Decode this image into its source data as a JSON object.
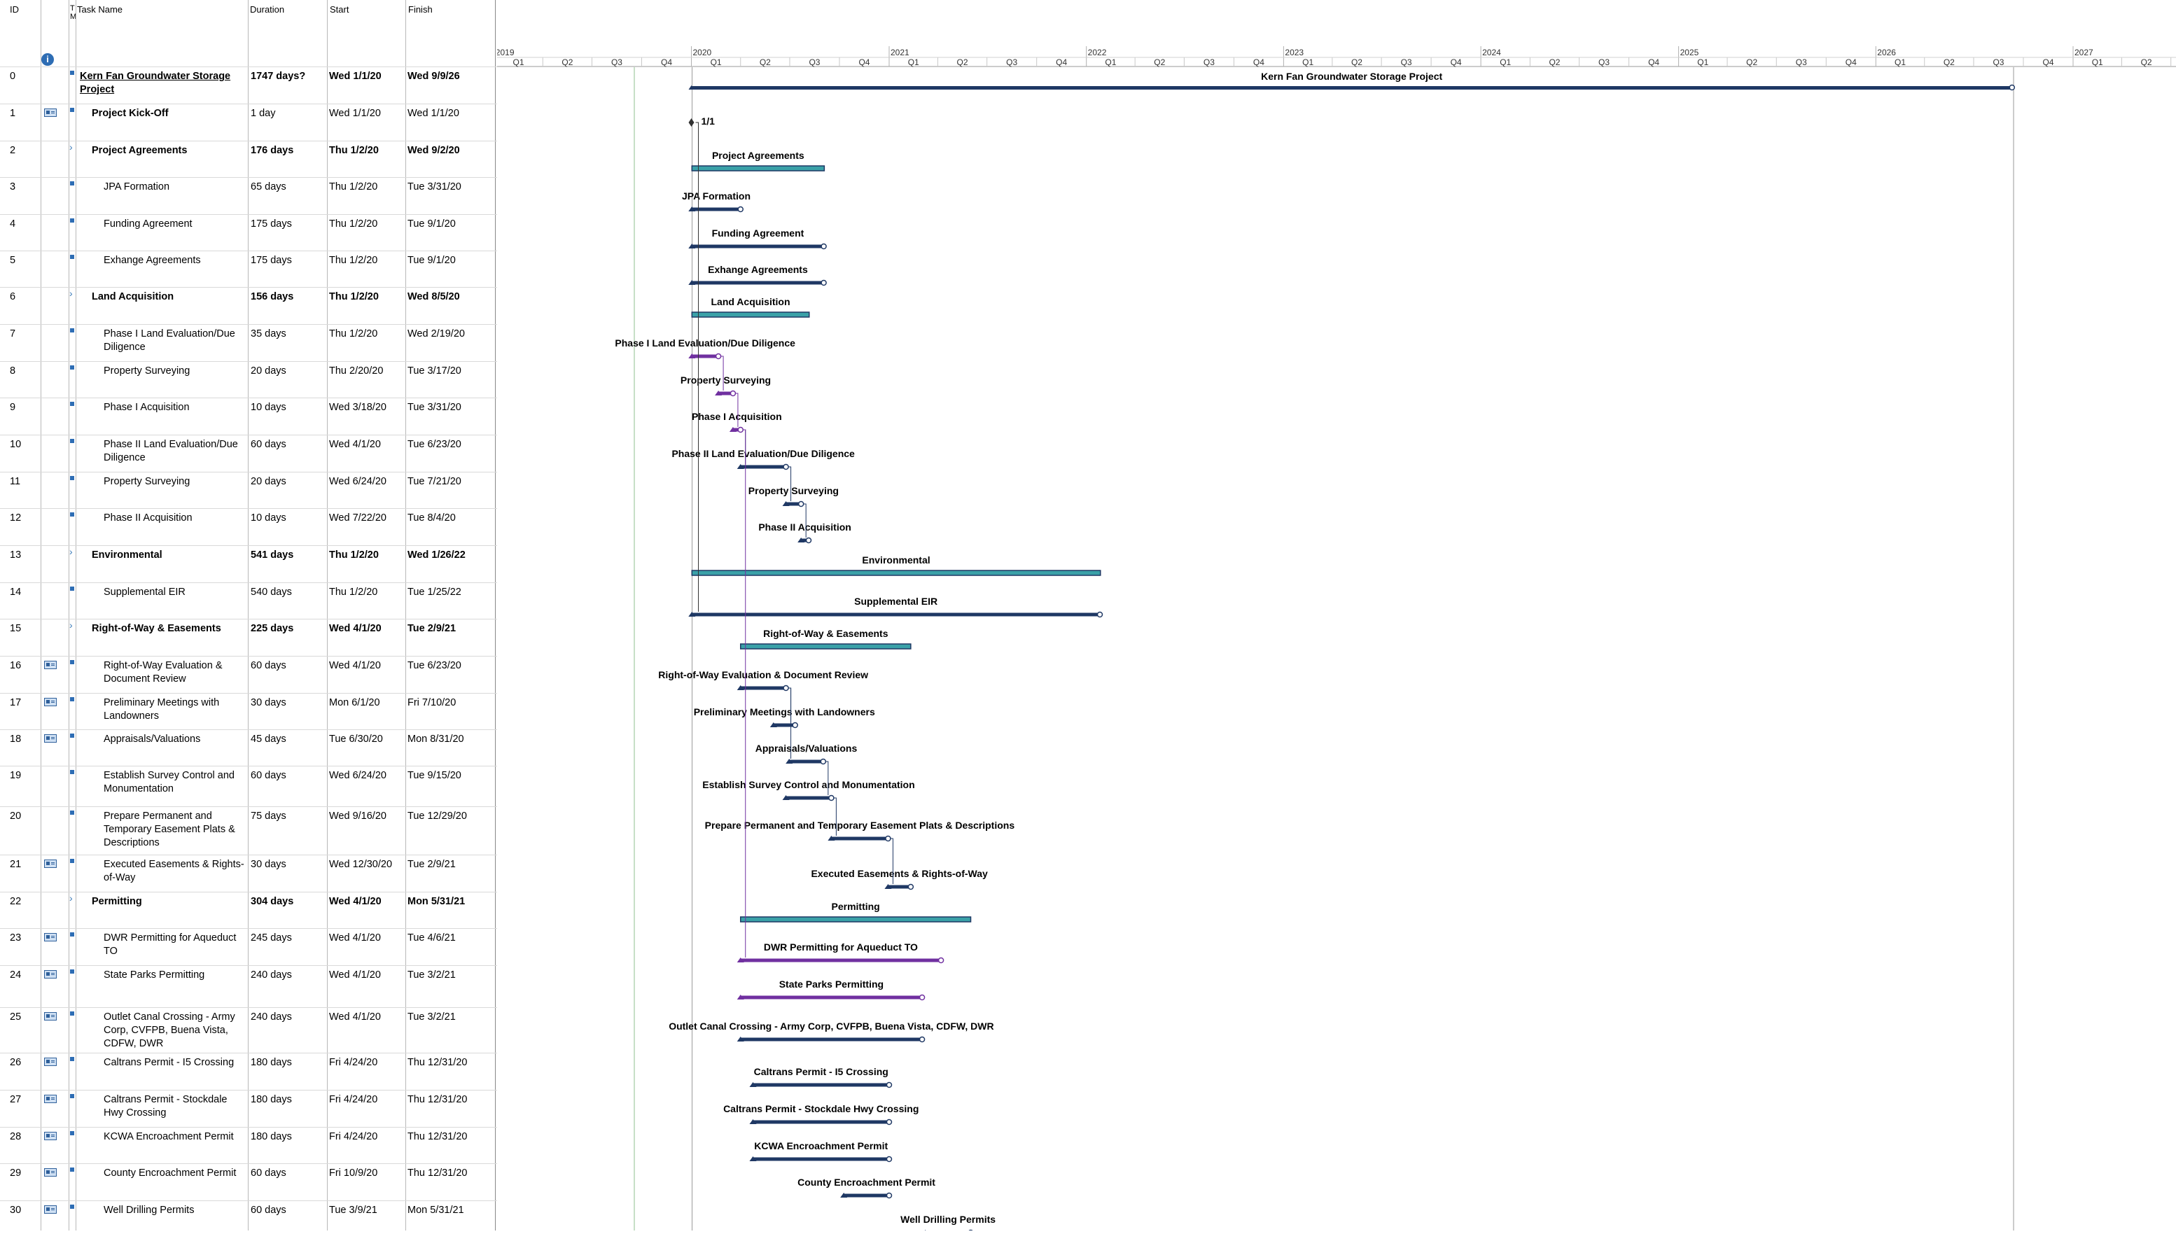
{
  "headers": {
    "id": "ID",
    "mode": "T M",
    "name": "Task Name",
    "duration": "Duration",
    "start": "Start",
    "finish": "Finish"
  },
  "timescale": {
    "years": [
      "2019",
      "2020",
      "2021",
      "2022",
      "2023",
      "2024",
      "2025",
      "2026",
      "2027"
    ],
    "quarters": [
      "Q1",
      "Q2",
      "Q3",
      "Q4"
    ]
  },
  "colors": {
    "task_bar": "#1f3864",
    "summary_bar": "#3aa1a8",
    "purple": "#7030a0",
    "link": "#333333"
  },
  "tasks": [
    {
      "id": "0",
      "name": "Kern Fan Groundwater Storage Project",
      "duration": "1747 days?",
      "start": "Wed 1/1/20",
      "finish": "Wed 9/9/26",
      "kind": "project",
      "has_note": false,
      "label": "Kern Fan Groundwater Storage Project"
    },
    {
      "id": "1",
      "name": "Project Kick-Off",
      "duration": "1 day",
      "start": "Wed 1/1/20",
      "finish": "Wed 1/1/20",
      "kind": "milestone",
      "has_note": true,
      "label": "1/1"
    },
    {
      "id": "2",
      "name": "Project Agreements",
      "duration": "176 days",
      "start": "Thu 1/2/20",
      "finish": "Wed 9/2/20",
      "kind": "summary",
      "has_note": false,
      "label": "Project Agreements"
    },
    {
      "id": "3",
      "name": "JPA Formation",
      "duration": "65 days",
      "start": "Thu 1/2/20",
      "finish": "Tue 3/31/20",
      "kind": "task",
      "has_note": false,
      "label": "JPA Formation"
    },
    {
      "id": "4",
      "name": "Funding Agreement",
      "duration": "175 days",
      "start": "Thu 1/2/20",
      "finish": "Tue 9/1/20",
      "kind": "task",
      "has_note": false,
      "label": "Funding Agreement"
    },
    {
      "id": "5",
      "name": "Exhange Agreements",
      "duration": "175 days",
      "start": "Thu 1/2/20",
      "finish": "Tue 9/1/20",
      "kind": "task",
      "has_note": false,
      "label": "Exhange Agreements"
    },
    {
      "id": "6",
      "name": "Land Acquisition",
      "duration": "156 days",
      "start": "Thu 1/2/20",
      "finish": "Wed 8/5/20",
      "kind": "summary",
      "has_note": false,
      "label": "Land Acquisition"
    },
    {
      "id": "7",
      "name": "Phase I Land Evaluation/Due Diligence",
      "duration": "35 days",
      "start": "Thu 1/2/20",
      "finish": "Wed 2/19/20",
      "kind": "critical",
      "has_note": false,
      "label": "Phase I Land Evaluation/Due Diligence"
    },
    {
      "id": "8",
      "name": "Property Surveying",
      "duration": "20 days",
      "start": "Thu 2/20/20",
      "finish": "Tue 3/17/20",
      "kind": "critical",
      "has_note": false,
      "label": "Property Surveying"
    },
    {
      "id": "9",
      "name": "Phase I Acquisition",
      "duration": "10 days",
      "start": "Wed 3/18/20",
      "finish": "Tue 3/31/20",
      "kind": "critical",
      "has_note": false,
      "label": "Phase I Acquisition"
    },
    {
      "id": "10",
      "name": "Phase II Land Evaluation/Due Diligence",
      "duration": "60 days",
      "start": "Wed 4/1/20",
      "finish": "Tue 6/23/20",
      "kind": "task",
      "has_note": false,
      "label": "Phase II Land Evaluation/Due Diligence"
    },
    {
      "id": "11",
      "name": "Property Surveying",
      "duration": "20 days",
      "start": "Wed 6/24/20",
      "finish": "Tue 7/21/20",
      "kind": "task",
      "has_note": false,
      "label": "Property Surveying"
    },
    {
      "id": "12",
      "name": "Phase II Acquisition",
      "duration": "10 days",
      "start": "Wed 7/22/20",
      "finish": "Tue 8/4/20",
      "kind": "task",
      "has_note": false,
      "label": "Phase II Acquisition"
    },
    {
      "id": "13",
      "name": "Environmental",
      "duration": "541 days",
      "start": "Thu 1/2/20",
      "finish": "Wed 1/26/22",
      "kind": "summary",
      "has_note": false,
      "label": "Environmental"
    },
    {
      "id": "14",
      "name": "Supplemental EIR",
      "duration": "540 days",
      "start": "Thu 1/2/20",
      "finish": "Tue 1/25/22",
      "kind": "task",
      "has_note": false,
      "label": "Supplemental EIR"
    },
    {
      "id": "15",
      "name": "Right-of-Way & Easements",
      "duration": "225 days",
      "start": "Wed 4/1/20",
      "finish": "Tue 2/9/21",
      "kind": "summary",
      "has_note": false,
      "label": "Right-of-Way & Easements"
    },
    {
      "id": "16",
      "name": "Right-of-Way Evaluation & Document Review",
      "duration": "60 days",
      "start": "Wed 4/1/20",
      "finish": "Tue 6/23/20",
      "kind": "task",
      "has_note": true,
      "label": "Right-of-Way Evaluation & Document Review"
    },
    {
      "id": "17",
      "name": "Preliminary Meetings with Landowners",
      "duration": "30 days",
      "start": "Mon 6/1/20",
      "finish": "Fri 7/10/20",
      "kind": "task",
      "has_note": true,
      "label": "Preliminary Meetings with Landowners"
    },
    {
      "id": "18",
      "name": "Appraisals/Valuations",
      "duration": "45 days",
      "start": "Tue 6/30/20",
      "finish": "Mon 8/31/20",
      "kind": "task",
      "has_note": true,
      "label": "Appraisals/Valuations"
    },
    {
      "id": "19",
      "name": "Establish Survey Control and Monumentation",
      "duration": "60 days",
      "start": "Wed 6/24/20",
      "finish": "Tue 9/15/20",
      "kind": "task",
      "has_note": false,
      "label": "Establish Survey Control and Monumentation"
    },
    {
      "id": "20",
      "name": "Prepare Permanent and Temporary Easement Plats & Descriptions",
      "duration": "75 days",
      "start": "Wed 9/16/20",
      "finish": "Tue 12/29/20",
      "kind": "task",
      "has_note": false,
      "label": "Prepare Permanent and Temporary Easement Plats & Descriptions"
    },
    {
      "id": "21",
      "name": "Executed Easements & Rights-of-Way",
      "duration": "30 days",
      "start": "Wed 12/30/20",
      "finish": "Tue 2/9/21",
      "kind": "task",
      "has_note": true,
      "label": "Executed Easements & Rights-of-Way"
    },
    {
      "id": "22",
      "name": "Permitting",
      "duration": "304 days",
      "start": "Wed 4/1/20",
      "finish": "Mon 5/31/21",
      "kind": "summary",
      "has_note": false,
      "label": "Permitting"
    },
    {
      "id": "23",
      "name": "DWR Permitting for Aqueduct TO",
      "duration": "245 days",
      "start": "Wed 4/1/20",
      "finish": "Tue 4/6/21",
      "kind": "critical",
      "has_note": true,
      "label": "DWR Permitting for Aqueduct TO"
    },
    {
      "id": "24",
      "name": "State Parks Permitting",
      "duration": "240 days",
      "start": "Wed 4/1/20",
      "finish": "Tue 3/2/21",
      "kind": "critical",
      "has_note": true,
      "label": "State Parks Permitting"
    },
    {
      "id": "25",
      "name": "Outlet Canal Crossing - Army Corp, CVFPB, Buena Vista, CDFW, DWR",
      "duration": "240 days",
      "start": "Wed 4/1/20",
      "finish": "Tue 3/2/21",
      "kind": "task",
      "has_note": true,
      "label": "Outlet Canal Crossing - Army Corp, CVFPB, Buena Vista, CDFW, DWR"
    },
    {
      "id": "26",
      "name": "Caltrans Permit - I5 Crossing",
      "duration": "180 days",
      "start": "Fri 4/24/20",
      "finish": "Thu 12/31/20",
      "kind": "task",
      "has_note": true,
      "label": "Caltrans Permit - I5 Crossing"
    },
    {
      "id": "27",
      "name": "Caltrans Permit - Stockdale Hwy Crossing",
      "duration": "180 days",
      "start": "Fri 4/24/20",
      "finish": "Thu 12/31/20",
      "kind": "task",
      "has_note": true,
      "label": "Caltrans Permit - Stockdale Hwy Crossing"
    },
    {
      "id": "28",
      "name": "KCWA Encroachment Permit",
      "duration": "180 days",
      "start": "Fri 4/24/20",
      "finish": "Thu 12/31/20",
      "kind": "task",
      "has_note": true,
      "label": "KCWA Encroachment Permit"
    },
    {
      "id": "29",
      "name": "County Encroachment Permit",
      "duration": "60 days",
      "start": "Fri 10/9/20",
      "finish": "Thu 12/31/20",
      "kind": "task",
      "has_note": true,
      "label": "County Encroachment Permit"
    },
    {
      "id": "30",
      "name": "Well Drilling Permits",
      "duration": "60 days",
      "start": "Tue 3/9/21",
      "finish": "Mon 5/31/21",
      "kind": "task",
      "has_note": true,
      "label": "Well Drilling Permits"
    }
  ]
}
